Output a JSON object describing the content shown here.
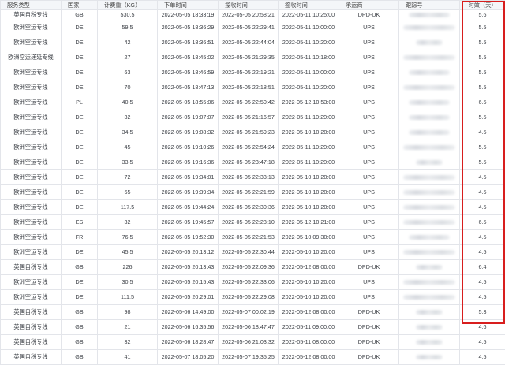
{
  "columns": [
    "服务类型",
    "国家",
    "计费重（KG）",
    "下单时间",
    "揽收时间",
    "签收时间",
    "承运商",
    "跟踪号",
    "时效（天）"
  ],
  "rows": [
    {
      "service": "英国自税专线",
      "country": "GB",
      "weight": "530.5",
      "order_time": "2022-05-05 18:33:19",
      "pickup_time": "2022-05-05 20:58:21",
      "sign_time": "2022-05-11 10:25:00",
      "carrier": "DPD-UK",
      "days": "5.6"
    },
    {
      "service": "欧洲空运专线",
      "country": "DE",
      "weight": "59.5",
      "order_time": "2022-05-05 18:36:29",
      "pickup_time": "2022-05-05 22:29:41",
      "sign_time": "2022-05-11 10:00:00",
      "carrier": "UPS",
      "days": "5.5"
    },
    {
      "service": "欧洲空运专线",
      "country": "DE",
      "weight": "42",
      "order_time": "2022-05-05 18:36:51",
      "pickup_time": "2022-05-05 22:44:04",
      "sign_time": "2022-05-11 10:20:00",
      "carrier": "UPS",
      "days": "5.5"
    },
    {
      "service": "欧洲空运递延专线",
      "country": "DE",
      "weight": "27",
      "order_time": "2022-05-05 18:45:02",
      "pickup_time": "2022-05-05 21:29:35",
      "sign_time": "2022-05-11 10:18:00",
      "carrier": "UPS",
      "days": "5.5"
    },
    {
      "service": "欧洲空运专线",
      "country": "DE",
      "weight": "63",
      "order_time": "2022-05-05 18:46:59",
      "pickup_time": "2022-05-05 22:19:21",
      "sign_time": "2022-05-11 10:00:00",
      "carrier": "UPS",
      "days": "5.5"
    },
    {
      "service": "欧洲空运专线",
      "country": "DE",
      "weight": "70",
      "order_time": "2022-05-05 18:47:13",
      "pickup_time": "2022-05-05 22:18:51",
      "sign_time": "2022-05-11 10:20:00",
      "carrier": "UPS",
      "days": "5.5"
    },
    {
      "service": "欧洲空运专线",
      "country": "PL",
      "weight": "40.5",
      "order_time": "2022-05-05 18:55:06",
      "pickup_time": "2022-05-05 22:50:42",
      "sign_time": "2022-05-12 10:53:00",
      "carrier": "UPS",
      "days": "6.5"
    },
    {
      "service": "欧洲空运专线",
      "country": "DE",
      "weight": "32",
      "order_time": "2022-05-05 19:07:07",
      "pickup_time": "2022-05-05 21:16:57",
      "sign_time": "2022-05-11 10:20:00",
      "carrier": "UPS",
      "days": "5.5"
    },
    {
      "service": "欧洲空运专线",
      "country": "DE",
      "weight": "34.5",
      "order_time": "2022-05-05 19:08:32",
      "pickup_time": "2022-05-05 21:59:23",
      "sign_time": "2022-05-10 10:20:00",
      "carrier": "UPS",
      "days": "4.5"
    },
    {
      "service": "欧洲空运专线",
      "country": "DE",
      "weight": "45",
      "order_time": "2022-05-05 19:10:26",
      "pickup_time": "2022-05-05 22:54:24",
      "sign_time": "2022-05-11 10:20:00",
      "carrier": "UPS",
      "days": "5.5"
    },
    {
      "service": "欧洲空运专线",
      "country": "DE",
      "weight": "33.5",
      "order_time": "2022-05-05 19:16:36",
      "pickup_time": "2022-05-05 23:47:18",
      "sign_time": "2022-05-11 10:20:00",
      "carrier": "UPS",
      "days": "5.5"
    },
    {
      "service": "欧洲空运专线",
      "country": "DE",
      "weight": "72",
      "order_time": "2022-05-05 19:34:01",
      "pickup_time": "2022-05-05 22:33:13",
      "sign_time": "2022-05-10 10:20:00",
      "carrier": "UPS",
      "days": "4.5"
    },
    {
      "service": "欧洲空运专线",
      "country": "DE",
      "weight": "65",
      "order_time": "2022-05-05 19:39:34",
      "pickup_time": "2022-05-05 22:21:59",
      "sign_time": "2022-05-10 10:20:00",
      "carrier": "UPS",
      "days": "4.5"
    },
    {
      "service": "欧洲空运专线",
      "country": "DE",
      "weight": "117.5",
      "order_time": "2022-05-05 19:44:24",
      "pickup_time": "2022-05-05 22:30:36",
      "sign_time": "2022-05-10 10:20:00",
      "carrier": "UPS",
      "days": "4.5"
    },
    {
      "service": "欧洲空运专线",
      "country": "ES",
      "weight": "32",
      "order_time": "2022-05-05 19:45:57",
      "pickup_time": "2022-05-05 22:23:10",
      "sign_time": "2022-05-12 10:21:00",
      "carrier": "UPS",
      "days": "6.5"
    },
    {
      "service": "欧洲空运专线",
      "country": "FR",
      "weight": "76.5",
      "order_time": "2022-05-05 19:52:30",
      "pickup_time": "2022-05-05 22:21:53",
      "sign_time": "2022-05-10 09:30:00",
      "carrier": "UPS",
      "days": "4.5"
    },
    {
      "service": "欧洲空运专线",
      "country": "DE",
      "weight": "45.5",
      "order_time": "2022-05-05 20:13:12",
      "pickup_time": "2022-05-05 22:30:44",
      "sign_time": "2022-05-10 10:20:00",
      "carrier": "UPS",
      "days": "4.5"
    },
    {
      "service": "英国自税专线",
      "country": "GB",
      "weight": "226",
      "order_time": "2022-05-05 20:13:43",
      "pickup_time": "2022-05-05 22:09:36",
      "sign_time": "2022-05-12 08:00:00",
      "carrier": "DPD-UK",
      "days": "6.4"
    },
    {
      "service": "欧洲空运专线",
      "country": "DE",
      "weight": "30.5",
      "order_time": "2022-05-05 20:15:43",
      "pickup_time": "2022-05-05 22:33:06",
      "sign_time": "2022-05-10 10:20:00",
      "carrier": "UPS",
      "days": "4.5"
    },
    {
      "service": "欧洲空运专线",
      "country": "DE",
      "weight": "111.5",
      "order_time": "2022-05-05 20:29:01",
      "pickup_time": "2022-05-05 22:29:08",
      "sign_time": "2022-05-10 10:20:00",
      "carrier": "UPS",
      "days": "4.5"
    },
    {
      "service": "英国自税专线",
      "country": "GB",
      "weight": "98",
      "order_time": "2022-05-06 14:49:00",
      "pickup_time": "2022-05-07 00:02:19",
      "sign_time": "2022-05-12 08:00:00",
      "carrier": "DPD-UK",
      "days": "5.3"
    },
    {
      "service": "英国自税专线",
      "country": "GB",
      "weight": "21",
      "order_time": "2022-05-06 16:35:56",
      "pickup_time": "2022-05-06 18:47:47",
      "sign_time": "2022-05-11 09:00:00",
      "carrier": "DPD-UK",
      "days": "4.6"
    },
    {
      "service": "英国自税专线",
      "country": "GB",
      "weight": "32",
      "order_time": "2022-05-06 18:28:47",
      "pickup_time": "2022-05-06 21:03:32",
      "sign_time": "2022-05-11 08:00:00",
      "carrier": "DPD-UK",
      "days": "4.5"
    },
    {
      "service": "英国自税专线",
      "country": "GB",
      "weight": "41",
      "order_time": "2022-05-07 18:05:20",
      "pickup_time": "2022-05-07 19:35:25",
      "sign_time": "2022-05-12 08:00:00",
      "carrier": "DPD-UK",
      "days": "4.5"
    }
  ]
}
